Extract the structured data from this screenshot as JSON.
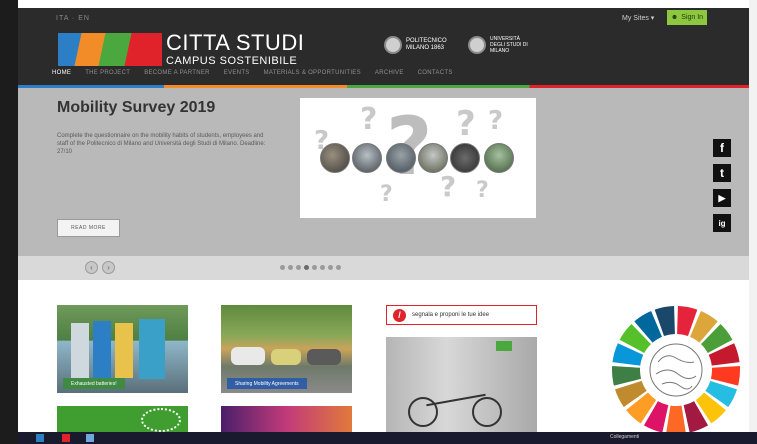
{
  "header": {
    "lang": "ITA · EN",
    "my_sites": "My Sites ▾",
    "sign_in": "Sign In",
    "logo_title": "CITTA STUDI",
    "logo_subtitle": "CAMPUS SOSTENIBILE",
    "polimi_label": "POLITECNICO MILANO 1863",
    "unimi_label": "UNIVERSITÀ DEGLI STUDI DI MILANO"
  },
  "nav": {
    "items": [
      "HOME",
      "THE PROJECT",
      "BECOME A PARTNER",
      "EVENTS",
      "MATERIALS & OPPORTUNITIES",
      "ARCHIVE",
      "CONTACTS"
    ]
  },
  "hero": {
    "title": "Mobility Survey 2019",
    "text": "Complete the questionnaire on the mobility habits of students, employees and staff of the Politecnico di Milano and Università degli Studi di Milano. Deadline: 27/10",
    "read_more": "READ MORE"
  },
  "social": [
    "f",
    "t",
    "▶",
    "ig"
  ],
  "slider": {
    "prev": "‹",
    "next": "›",
    "slide_count": 8,
    "active_slide": 3
  },
  "tiles": {
    "tile1_caption": "Exhausted batteries!",
    "tile2_caption": "Sharing Mobility Agreements",
    "report_label": "segnala e proponi le tue idee"
  },
  "taskbar": {
    "connection": "Collegamenti"
  },
  "colors": {
    "blue": "#2c7fc4",
    "orange": "#f28c28",
    "green": "#4aa83f",
    "red": "#e0232a",
    "signin_green": "#8dc63f"
  }
}
